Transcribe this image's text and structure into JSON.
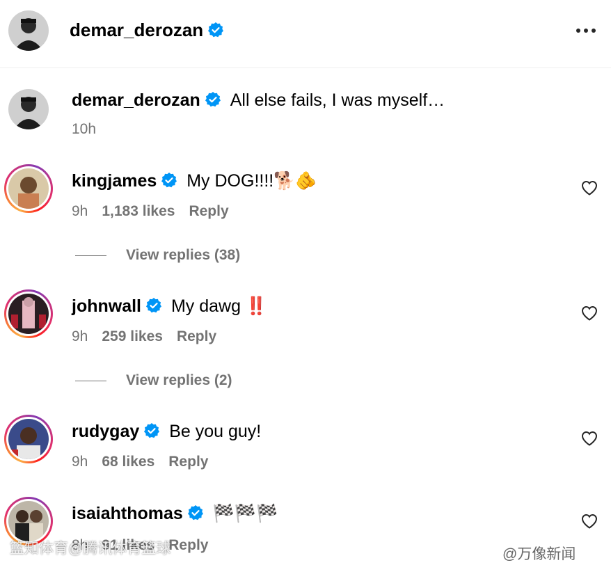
{
  "header": {
    "username": "demar_derozan"
  },
  "caption": {
    "username": "demar_derozan",
    "text": "All else fails, I was myself…",
    "time": "10h"
  },
  "comments": [
    {
      "username": "kingjames",
      "text": "My DOG!!!!🐕🫵",
      "time": "9h",
      "likes": "1,183 likes",
      "reply": "Reply",
      "view_replies": "View replies (38)"
    },
    {
      "username": "johnwall",
      "text": "My dawg ‼️",
      "time": "9h",
      "likes": "259 likes",
      "reply": "Reply",
      "view_replies": "View replies (2)"
    },
    {
      "username": "rudygay",
      "text": "Be you guy!",
      "time": "9h",
      "likes": "68 likes",
      "reply": "Reply"
    },
    {
      "username": "isaiahthomas",
      "text": "🏁🏁🏁",
      "time": "8h",
      "likes": "91 likes",
      "reply": "Reply"
    }
  ],
  "watermarks": {
    "left": "篮知体育@腾讯体育篮球",
    "right": "@万像新闻"
  },
  "colors": {
    "verified": "#0095f6",
    "muted": "#737373",
    "emphasis": "#e0245e"
  },
  "icons": [
    "more-options-icon",
    "verified-badge-icon",
    "heart-icon"
  ]
}
